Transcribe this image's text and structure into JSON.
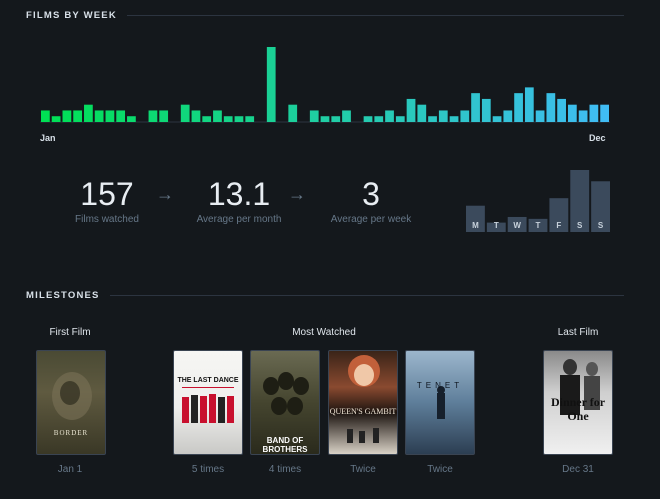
{
  "films_by_week": {
    "title": "FILMS BY WEEK",
    "start_label": "Jan",
    "end_label": "Dec"
  },
  "chart_data": {
    "type": "bar",
    "title": "FILMS BY WEEK",
    "x_labels": [
      "Jan",
      "Dec"
    ],
    "values": [
      2,
      1,
      2,
      2,
      3,
      2,
      2,
      2,
      1,
      0,
      2,
      2,
      0,
      3,
      2,
      1,
      2,
      1,
      1,
      1,
      0,
      13,
      0,
      3,
      0,
      2,
      1,
      1,
      2,
      0,
      1,
      1,
      2,
      1,
      4,
      3,
      1,
      2,
      1,
      2,
      5,
      4,
      1,
      2,
      5,
      6,
      2,
      5,
      4,
      3,
      2,
      3,
      3
    ],
    "colors": [
      "#00e054",
      "#40bcf4"
    ],
    "grid": false
  },
  "stats": {
    "films_watched": {
      "value": "157",
      "label": "Films watched"
    },
    "avg_month": {
      "value": "13.1",
      "label": "Average per month"
    },
    "avg_week": {
      "value": "3",
      "label": "Average per week"
    }
  },
  "day_chart": {
    "type": "bar",
    "categories": [
      "M",
      "T",
      "W",
      "T",
      "F",
      "S",
      "S"
    ],
    "values": [
      14,
      5,
      8,
      7,
      18,
      33,
      27
    ],
    "color": "#3b4a5c"
  },
  "milestones": {
    "title": "MILESTONES",
    "first_film": {
      "heading": "First Film",
      "poster_title": "BORDER",
      "caption": "Jan 1"
    },
    "most_watched": {
      "heading": "Most Watched",
      "films": [
        {
          "poster_title": "THE LAST DANCE",
          "caption": "5 times"
        },
        {
          "poster_title": "BAND OF BROTHERS",
          "caption": "4 times"
        },
        {
          "poster_title": "QUEEN'S GAMBIT",
          "caption": "Twice"
        },
        {
          "poster_title": "TENET",
          "caption": "Twice"
        }
      ]
    },
    "last_film": {
      "heading": "Last Film",
      "poster_title": "Dinner for One",
      "caption": "Dec 31"
    }
  }
}
